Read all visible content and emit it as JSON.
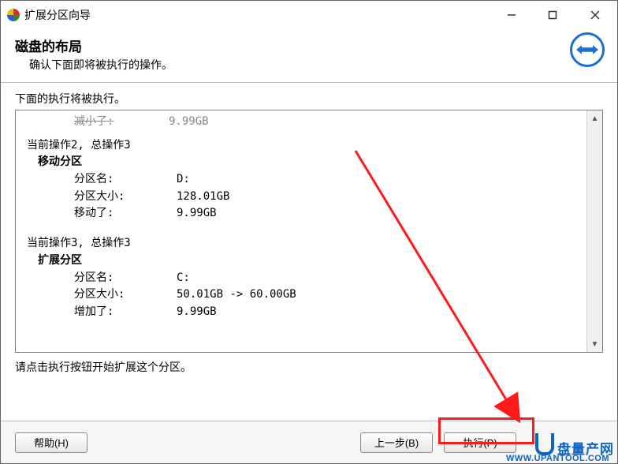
{
  "window": {
    "title": "扩展分区向导"
  },
  "header": {
    "title": "磁盘的布局",
    "subtitle": "确认下面即将被执行的操作。"
  },
  "section_label": "下面的执行将被执行。",
  "truncated_row": {
    "label": "减小了:",
    "value": "9.99GB"
  },
  "ops": [
    {
      "heading": "当前操作2, 总操作3",
      "subheading": "移动分区",
      "rows": [
        {
          "label": "分区名:",
          "value": "D:"
        },
        {
          "label": "分区大小:",
          "value": "128.01GB"
        },
        {
          "label": "移动了:",
          "value": "9.99GB"
        }
      ]
    },
    {
      "heading": "当前操作3, 总操作3",
      "subheading": "扩展分区",
      "rows": [
        {
          "label": "分区名:",
          "value": "C:"
        },
        {
          "label": "分区大小:",
          "value": "50.01GB -> 60.00GB"
        },
        {
          "label": "增加了:",
          "value": "9.99GB"
        }
      ]
    }
  ],
  "hint": "请点击执行按钮开始扩展这个分区。",
  "buttons": {
    "help": "帮助(H)",
    "back": "上一步(B)",
    "execute": "执行(P)"
  },
  "watermark": {
    "brand": "盘量产网",
    "url": "WWW.UPANTOOL.COM"
  }
}
